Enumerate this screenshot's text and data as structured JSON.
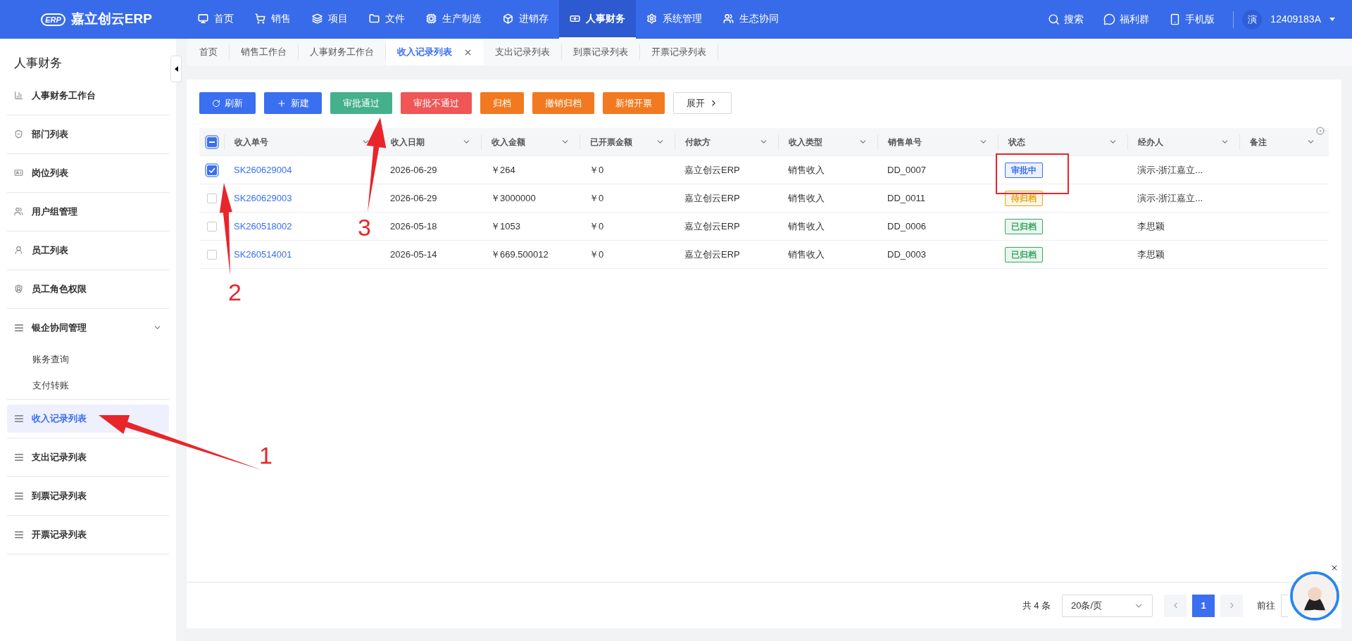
{
  "header": {
    "logo_text": "嘉立创云ERP",
    "logo_badge": "ERP",
    "nav": [
      {
        "label": "首页",
        "selected": false
      },
      {
        "label": "销售",
        "selected": false
      },
      {
        "label": "项目",
        "selected": false
      },
      {
        "label": "文件",
        "selected": false
      },
      {
        "label": "生产制造",
        "selected": false
      },
      {
        "label": "进销存",
        "selected": false
      },
      {
        "label": "人事财务",
        "selected": true
      },
      {
        "label": "系统管理",
        "selected": false
      },
      {
        "label": "生态协同",
        "selected": false
      }
    ],
    "actions": [
      "搜索",
      "福利群",
      "手机版"
    ],
    "user": {
      "avatar_text": "演",
      "id": "12409183A"
    }
  },
  "tabs": [
    {
      "label": "首页",
      "selected": false
    },
    {
      "label": "销售工作台",
      "selected": false
    },
    {
      "label": "人事财务工作台",
      "selected": false
    },
    {
      "label": "收入记录列表",
      "selected": true
    },
    {
      "label": "支出记录列表",
      "selected": false
    },
    {
      "label": "到票记录列表",
      "selected": false
    },
    {
      "label": "开票记录列表",
      "selected": false
    }
  ],
  "sidebar": {
    "title": "人事财务",
    "items": [
      {
        "label": "人事财务工作台",
        "selected": false
      },
      {
        "label": "部门列表",
        "selected": false
      },
      {
        "label": "岗位列表",
        "selected": false
      },
      {
        "label": "用户组管理",
        "selected": false
      },
      {
        "label": "员工列表",
        "selected": false
      },
      {
        "label": "员工角色权限",
        "selected": false
      },
      {
        "label": "银企协同管理",
        "selected": false,
        "expanded": true,
        "children": [
          {
            "label": "账务查询",
            "selected": false
          },
          {
            "label": "支付转账",
            "selected": false
          }
        ]
      },
      {
        "label": "收入记录列表",
        "selected": true
      },
      {
        "label": "支出记录列表",
        "selected": false
      },
      {
        "label": "到票记录列表",
        "selected": false
      },
      {
        "label": "开票记录列表",
        "selected": false
      }
    ]
  },
  "toolbar": [
    {
      "label": "刷新",
      "kind": "refresh",
      "color": "#3a6ff0"
    },
    {
      "label": "新建",
      "kind": "add",
      "color": "#3a6ff0"
    },
    {
      "label": "审批通过",
      "kind": "plain",
      "color": "#45b08c"
    },
    {
      "label": "审批不通过",
      "kind": "plain",
      "color": "#f05656"
    },
    {
      "label": "归档",
      "kind": "plain",
      "color": "#f2791f"
    },
    {
      "label": "撤销归档",
      "kind": "plain",
      "color": "#f2791f"
    },
    {
      "label": "新增开票",
      "kind": "plain",
      "color": "#f2791f"
    },
    {
      "label": "展开",
      "kind": "expand",
      "color": "#ffffff"
    }
  ],
  "table": {
    "select_all_indeterminate": true,
    "columns": [
      "收入单号",
      "收入日期",
      "收入金额",
      "已开票金额",
      "付款方",
      "收入类型",
      "销售单号",
      "状态",
      "经办人",
      "备注"
    ],
    "rows": [
      {
        "checked": true,
        "cells": [
          "SK260629004",
          "2026-06-29",
          "￥264",
          "￥0",
          "嘉立创云ERP",
          "销售收入",
          "DD_0007"
        ],
        "status": {
          "label": "审批中",
          "color": "#3a6ff0"
        },
        "handler": "演示-浙江嘉立..."
      },
      {
        "checked": false,
        "cells": [
          "SK260629003",
          "2026-06-29",
          "￥3000000",
          "￥0",
          "嘉立创云ERP",
          "销售收入",
          "DD_0011"
        ],
        "status": {
          "label": "待归档",
          "color": "#e6a817"
        },
        "handler": "演示-浙江嘉立..."
      },
      {
        "checked": false,
        "cells": [
          "SK260518002",
          "2026-05-18",
          "￥1053",
          "￥0",
          "嘉立创云ERP",
          "销售收入",
          "DD_0006"
        ],
        "status": {
          "label": "已归档",
          "color": "#3aa564"
        },
        "handler": "李思颖"
      },
      {
        "checked": false,
        "cells": [
          "SK260514001",
          "2026-05-14",
          "￥669.500012",
          "￥0",
          "嘉立创云ERP",
          "销售收入",
          "DD_0003"
        ],
        "status": {
          "label": "已归档",
          "color": "#3aa564"
        },
        "handler": "李思颖"
      }
    ]
  },
  "pagination": {
    "total": "共 4 条",
    "page_size": "20条/页",
    "pages": [
      {
        "label": "1",
        "selected": true
      }
    ],
    "goto": "前往"
  },
  "annotations": [
    {
      "kind": "arrow",
      "label": "1"
    },
    {
      "kind": "arrow",
      "label": "2"
    },
    {
      "kind": "arrow",
      "label": "3"
    },
    {
      "kind": "box"
    }
  ]
}
